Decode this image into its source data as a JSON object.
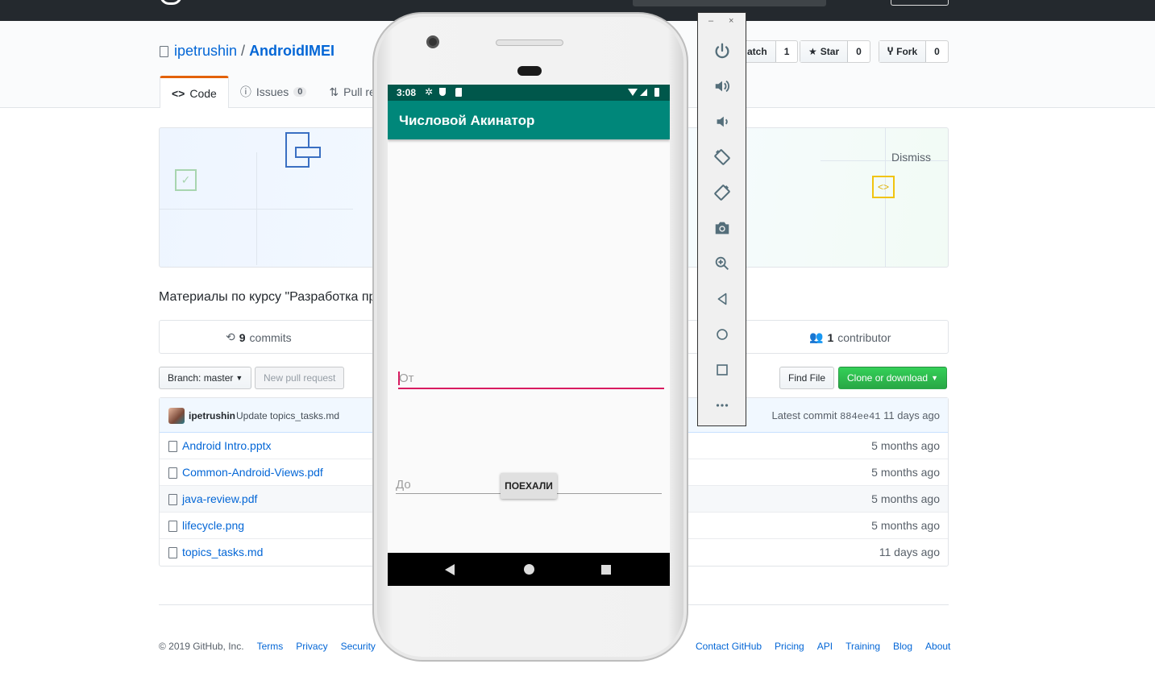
{
  "github": {
    "repo_owner": "ipetrushin",
    "repo_separator": "/",
    "repo_name": "AndroidIMEI",
    "watch_label": "atch",
    "watch_count": "1",
    "star_label": "Star",
    "star_count": "0",
    "fork_label": "Fork",
    "fork_count": "0",
    "tabs": [
      {
        "label": "Code"
      },
      {
        "label": "Issues",
        "count": "0"
      },
      {
        "label": "Pull req"
      }
    ],
    "banner_dismiss": "Dismiss",
    "description": "Материалы по курсу \"Разработка пр",
    "commits_count": "9",
    "commits_label": "commits",
    "contributors_count": "1",
    "contributors_label": "contributor",
    "branch_label": "Branch: master",
    "new_pr_label": "New pull request",
    "find_file_label": "Find File",
    "clone_label": "Clone or download",
    "commit": {
      "author": "ipetrushin",
      "message": "Update topics_tasks.md",
      "latest_label": "Latest commit",
      "sha": "884ee41",
      "age": "11 days ago"
    },
    "files": [
      {
        "name": "Android Intro.pptx",
        "age": "5 months ago"
      },
      {
        "name": "Common-Android-Views.pdf",
        "age": "5 months ago"
      },
      {
        "name": "java-review.pdf",
        "age": "5 months ago"
      },
      {
        "name": "lifecycle.png",
        "age": "5 months ago"
      },
      {
        "name": "topics_tasks.md",
        "age": "11 days ago"
      }
    ],
    "footer_left": [
      "© 2019 GitHub, Inc.",
      "Terms",
      "Privacy",
      "Security"
    ],
    "footer_right": [
      "Contact GitHub",
      "Pricing",
      "API",
      "Training",
      "Blog",
      "About"
    ]
  },
  "phone": {
    "time": "3:08",
    "app_title": "Числовой Акинатор",
    "field_from_placeholder": "От",
    "field_to_placeholder": "До",
    "go_button": "ПОЕХАЛИ"
  },
  "emulator": {
    "minimize": "–",
    "close": "×",
    "buttons": [
      "power-icon",
      "volume-up-icon",
      "volume-down-icon",
      "rotate-left-icon",
      "rotate-right-icon",
      "camera-icon",
      "zoom-icon",
      "back-icon",
      "home-icon",
      "overview-icon",
      "more-icon"
    ]
  },
  "colors": {
    "app_bar": "#00877a",
    "status_bar": "#00574b",
    "accent": "#d81b60",
    "github_link": "#0366d6",
    "github_green": "#28a745"
  }
}
